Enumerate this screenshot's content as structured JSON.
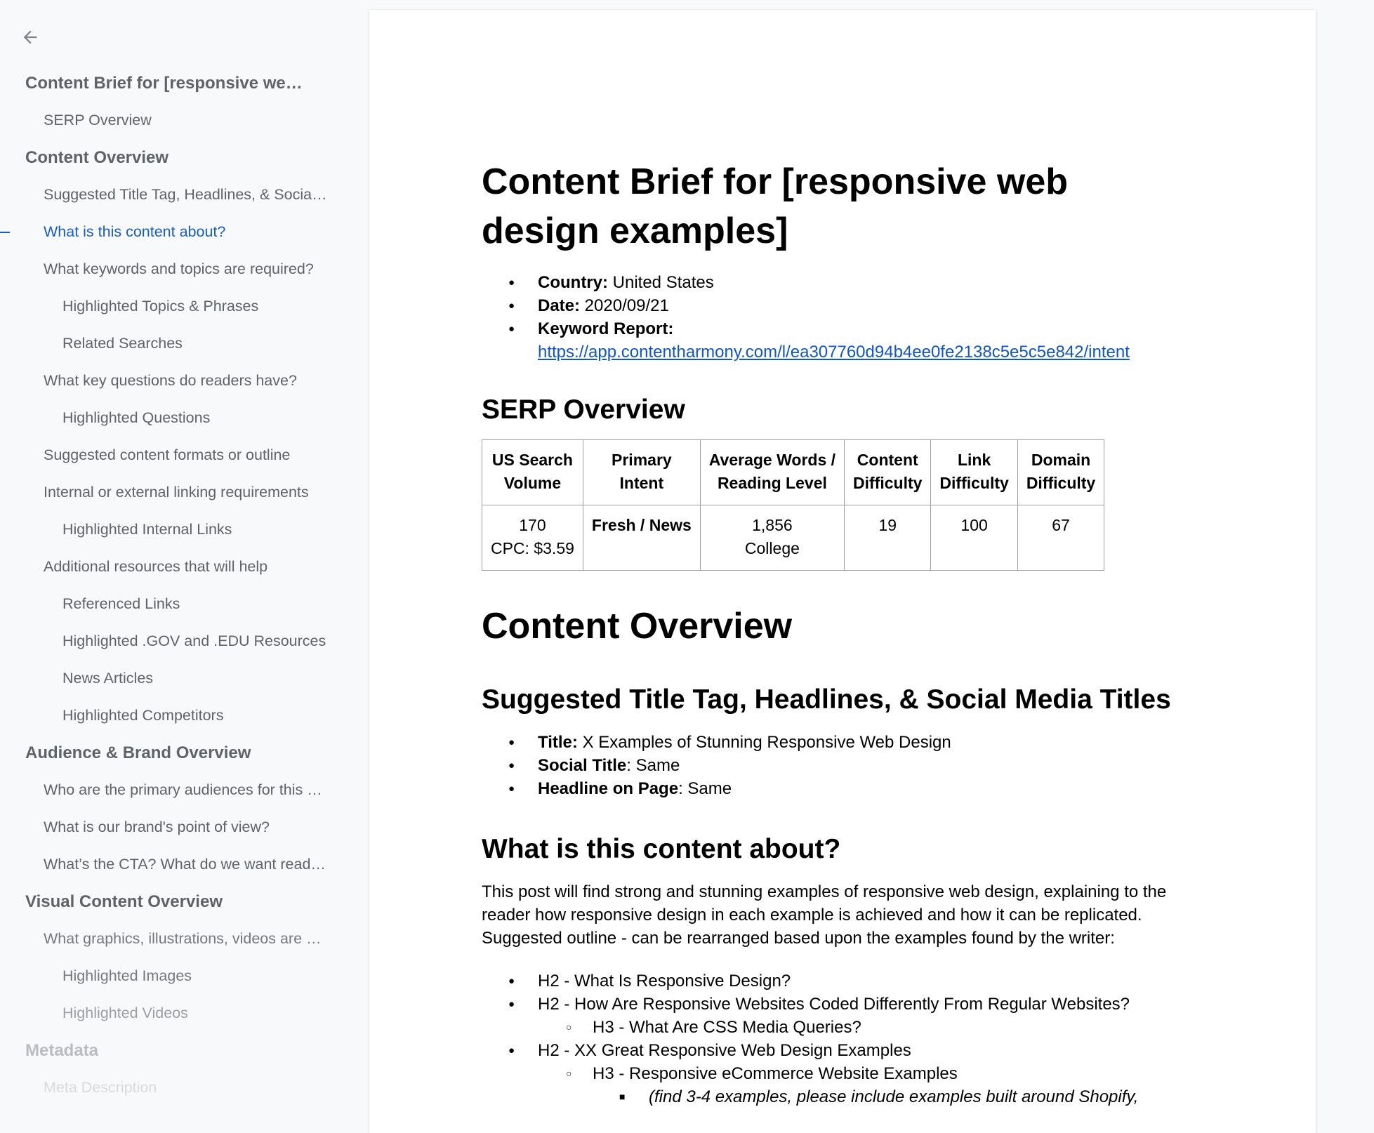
{
  "sidebar": {
    "back_label": "Back",
    "items": [
      {
        "label": "Content Brief for [responsive web design examples]",
        "level": 1
      },
      {
        "label": "SERP Overview",
        "level": 2
      },
      {
        "label": "Content Overview",
        "level": 1
      },
      {
        "label": "Suggested Title Tag, Headlines, & Social Media Titles",
        "level": 2
      },
      {
        "label": "What is this content about?",
        "level": 2,
        "active": true
      },
      {
        "label": "What keywords and topics are required?",
        "level": 2
      },
      {
        "label": "Highlighted Topics & Phrases",
        "level": 3
      },
      {
        "label": "Related Searches",
        "level": 3
      },
      {
        "label": "What key questions do readers have?",
        "level": 2
      },
      {
        "label": "Highlighted Questions",
        "level": 3
      },
      {
        "label": "Suggested content formats or outline",
        "level": 2
      },
      {
        "label": "Internal or external linking requirements",
        "level": 2
      },
      {
        "label": "Highlighted Internal Links",
        "level": 3
      },
      {
        "label": "Additional resources that will help",
        "level": 2
      },
      {
        "label": "Referenced Links",
        "level": 3
      },
      {
        "label": "Highlighted .GOV and .EDU Resources",
        "level": 3
      },
      {
        "label": "News Articles",
        "level": 3
      },
      {
        "label": "Highlighted Competitors",
        "level": 3
      },
      {
        "label": "Audience & Brand Overview",
        "level": 1
      },
      {
        "label": "Who are the primary audiences for this content?",
        "level": 2
      },
      {
        "label": "What is our brand's point of view?",
        "level": 2
      },
      {
        "label": "What’s the CTA? What do we want readers to do?",
        "level": 2
      },
      {
        "label": "Visual Content Overview",
        "level": 1
      },
      {
        "label": "What graphics, illustrations, videos are needed?",
        "level": 2
      },
      {
        "label": "Highlighted Images",
        "level": 3
      },
      {
        "label": "Highlighted Videos",
        "level": 3
      },
      {
        "label": "Metadata",
        "level": 1
      },
      {
        "label": "Meta Description",
        "level": 2
      }
    ]
  },
  "document": {
    "title": "Content Brief for [responsive web design examples]",
    "meta": {
      "country_label": "Country:",
      "country_value": " United States",
      "date_label": "Date:",
      "date_value": " 2020/09/21",
      "keyword_report_label": "Keyword Report:",
      "keyword_report_url": "https://app.contentharmony.com/l/ea307760d94b4ee0fe2138c5e5c5e842/intent"
    },
    "serp_heading": "SERP Overview",
    "serp_table": {
      "headers": [
        [
          "US Search",
          "Volume"
        ],
        [
          "Primary",
          "Intent"
        ],
        [
          "Average Words /",
          "Reading Level"
        ],
        [
          "Content",
          "Difficulty"
        ],
        [
          "Link",
          "Difficulty"
        ],
        [
          "Domain",
          "Difficulty"
        ]
      ],
      "row": [
        [
          "170",
          "CPC: $3.59"
        ],
        [
          "Fresh / News"
        ],
        [
          "1,856",
          "College"
        ],
        [
          "19"
        ],
        [
          "100"
        ],
        [
          "67"
        ]
      ]
    },
    "content_overview_heading": "Content Overview",
    "titles_heading": "Suggested Title Tag, Headlines, & Social Media Titles",
    "titles": [
      {
        "label": "Title:",
        "value": " X Examples of Stunning Responsive Web Design"
      },
      {
        "label": "Social Title",
        "value": ": Same"
      },
      {
        "label": "Headline on Page",
        "value": ": Same"
      }
    ],
    "about_heading": "What is this content about?",
    "about_paragraph": "This post will find strong and stunning examples of responsive web design, explaining to the reader how responsive design in each example is achieved and how it can be replicated. Suggested outline - can be rearranged based upon the examples found by the writer:",
    "outline": [
      {
        "text": "H2 - What Is Responsive Design?",
        "level": 1
      },
      {
        "text": "H2 - How Are Responsive Websites Coded Differently From Regular Websites?",
        "level": 1
      },
      {
        "text": "H3 - What Are CSS Media Queries?",
        "level": 2
      },
      {
        "text": "H2 - XX Great Responsive Web Design Examples",
        "level": 1
      },
      {
        "text": "H3 - Responsive eCommerce Website Examples",
        "level": 2
      },
      {
        "text": "(find 3-4 examples, please include examples built around Shopify,",
        "level": 3
      }
    ]
  },
  "colors": {
    "sidebar_bg": "#f8f9fa",
    "sidebar_text": "#5f6368",
    "active": "#1a5dc8",
    "link": "#1155cc",
    "page_bg": "#ffffff"
  }
}
